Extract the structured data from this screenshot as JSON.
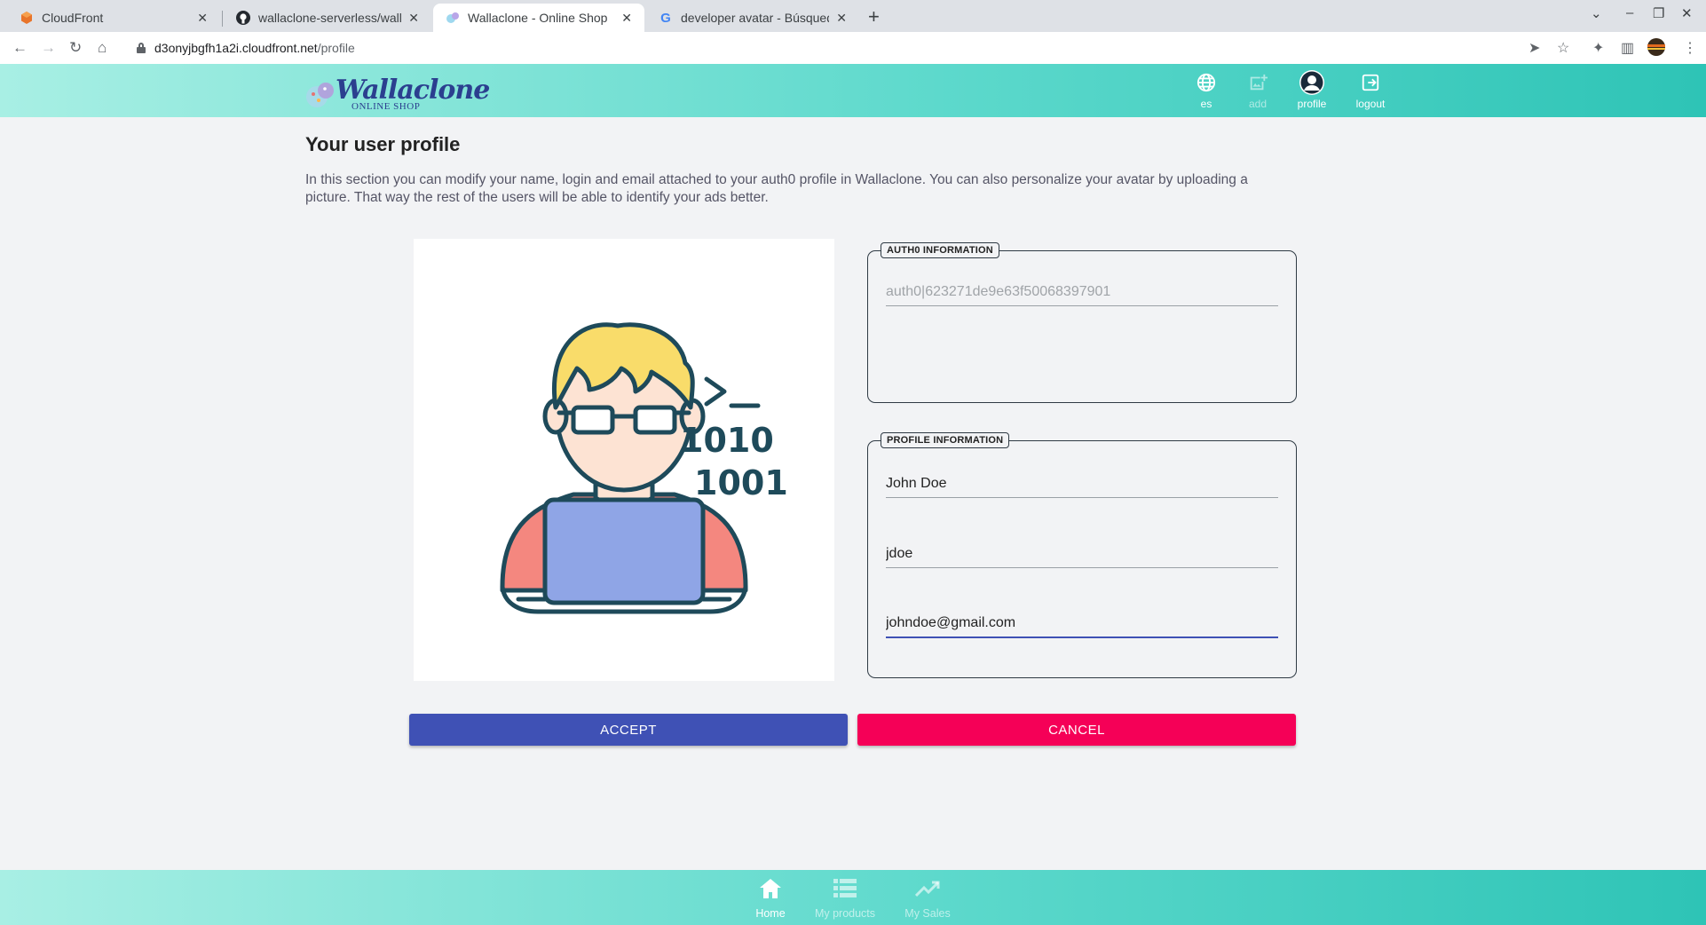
{
  "browser": {
    "tabs": [
      {
        "title": "CloudFront",
        "icon": "aws-icon"
      },
      {
        "title": "wallaclone-serverless/wallaclone",
        "icon": "github-icon"
      },
      {
        "title": "Wallaclone - Online Shop",
        "icon": "wallaclone-icon"
      },
      {
        "title": "developer avatar - Búsqueda de Google",
        "icon": "google-icon"
      }
    ],
    "url_host": "d3onyjbgfh1a2i.cloudfront.net",
    "url_path": "/profile"
  },
  "header": {
    "logo_text": "Wallaclone",
    "logo_subtext": "ONLINE SHOP",
    "nav": [
      {
        "label": "es",
        "icon": "globe-icon"
      },
      {
        "label": "add",
        "icon": "add-photo-icon"
      },
      {
        "label": "profile",
        "icon": "account-circle-icon"
      },
      {
        "label": "logout",
        "icon": "logout-icon"
      }
    ]
  },
  "main": {
    "title": "Your user profile",
    "description": "In this section you can modify your name, login and email attached to your auth0 profile in Wallaclone. You can also personalize your avatar by uploading a picture. That way the rest of the users will be able to identify your ads better.",
    "avatar_code_text": ">_",
    "avatar_binary_1": "1010",
    "avatar_binary_2": "1001",
    "auth0": {
      "legend": "AUTH0 INFORMATION",
      "user_id": "auth0|623271de9e63f50068397901"
    },
    "profile": {
      "legend": "PROFILE INFORMATION",
      "name": "John Doe",
      "login": "jdoe",
      "email": "johndoe@gmail.com"
    },
    "accept_label": "ACCEPT",
    "cancel_label": "CANCEL"
  },
  "bottom_nav": [
    {
      "label": "Home",
      "icon": "home-icon",
      "active": true
    },
    {
      "label": "My products",
      "icon": "list-icon",
      "active": false
    },
    {
      "label": "My Sales",
      "icon": "trending-up-icon",
      "active": false
    }
  ],
  "colors": {
    "primary": "#3f51b5",
    "secondary": "#f50057",
    "header_gradient_start": "#a8efe4",
    "header_gradient_end": "#2ec4b6"
  }
}
